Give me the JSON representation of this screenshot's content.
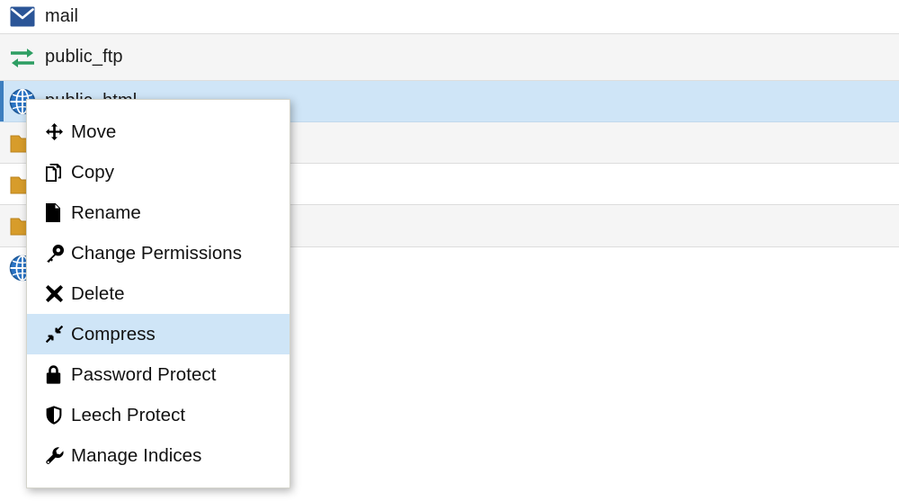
{
  "file_list": {
    "rows": [
      {
        "name": "mail",
        "icon": "envelope-icon",
        "striped": false,
        "selected": false
      },
      {
        "name": "public_ftp",
        "icon": "ftp-arrows-icon",
        "striped": true,
        "selected": false
      },
      {
        "name": "public_html",
        "icon": "globe-icon",
        "striped": false,
        "selected": true
      },
      {
        "name": "",
        "icon": "folder-icon",
        "striped": true,
        "selected": false
      },
      {
        "name": "",
        "icon": "folder-icon",
        "striped": false,
        "selected": false
      },
      {
        "name": "",
        "icon": "folder-icon",
        "striped": true,
        "selected": false
      },
      {
        "name": "",
        "icon": "globe-icon",
        "striped": false,
        "selected": false
      }
    ]
  },
  "context_menu": {
    "items": [
      {
        "label": "Move",
        "icon": "arrows-move-icon",
        "highlighted": false
      },
      {
        "label": "Copy",
        "icon": "copy-files-icon",
        "highlighted": false
      },
      {
        "label": "Rename",
        "icon": "file-icon",
        "highlighted": false
      },
      {
        "label": "Change Permissions",
        "icon": "key-icon",
        "highlighted": false
      },
      {
        "label": "Delete",
        "icon": "x-mark-icon",
        "highlighted": false
      },
      {
        "label": "Compress",
        "icon": "compress-icon",
        "highlighted": true
      },
      {
        "label": "Password Protect",
        "icon": "lock-icon",
        "highlighted": false
      },
      {
        "label": "Leech Protect",
        "icon": "shield-icon",
        "highlighted": false
      },
      {
        "label": "Manage Indices",
        "icon": "wrench-icon",
        "highlighted": false
      }
    ]
  },
  "colors": {
    "selected_row": "#cfe5f7",
    "selected_row_accent": "#3c7ebf",
    "striped_row": "#f5f5f5",
    "row_border": "#dddddd",
    "envelope_blue": "#2b5597",
    "ftp_green": "#2e9e63",
    "globe_blue": "#2b74c4",
    "folder_orange": "#d79c2b",
    "menu_background": "#ffffff",
    "menu_border": "#d4d4cb",
    "menu_highlight": "#cfe5f7",
    "text": "#111111"
  }
}
